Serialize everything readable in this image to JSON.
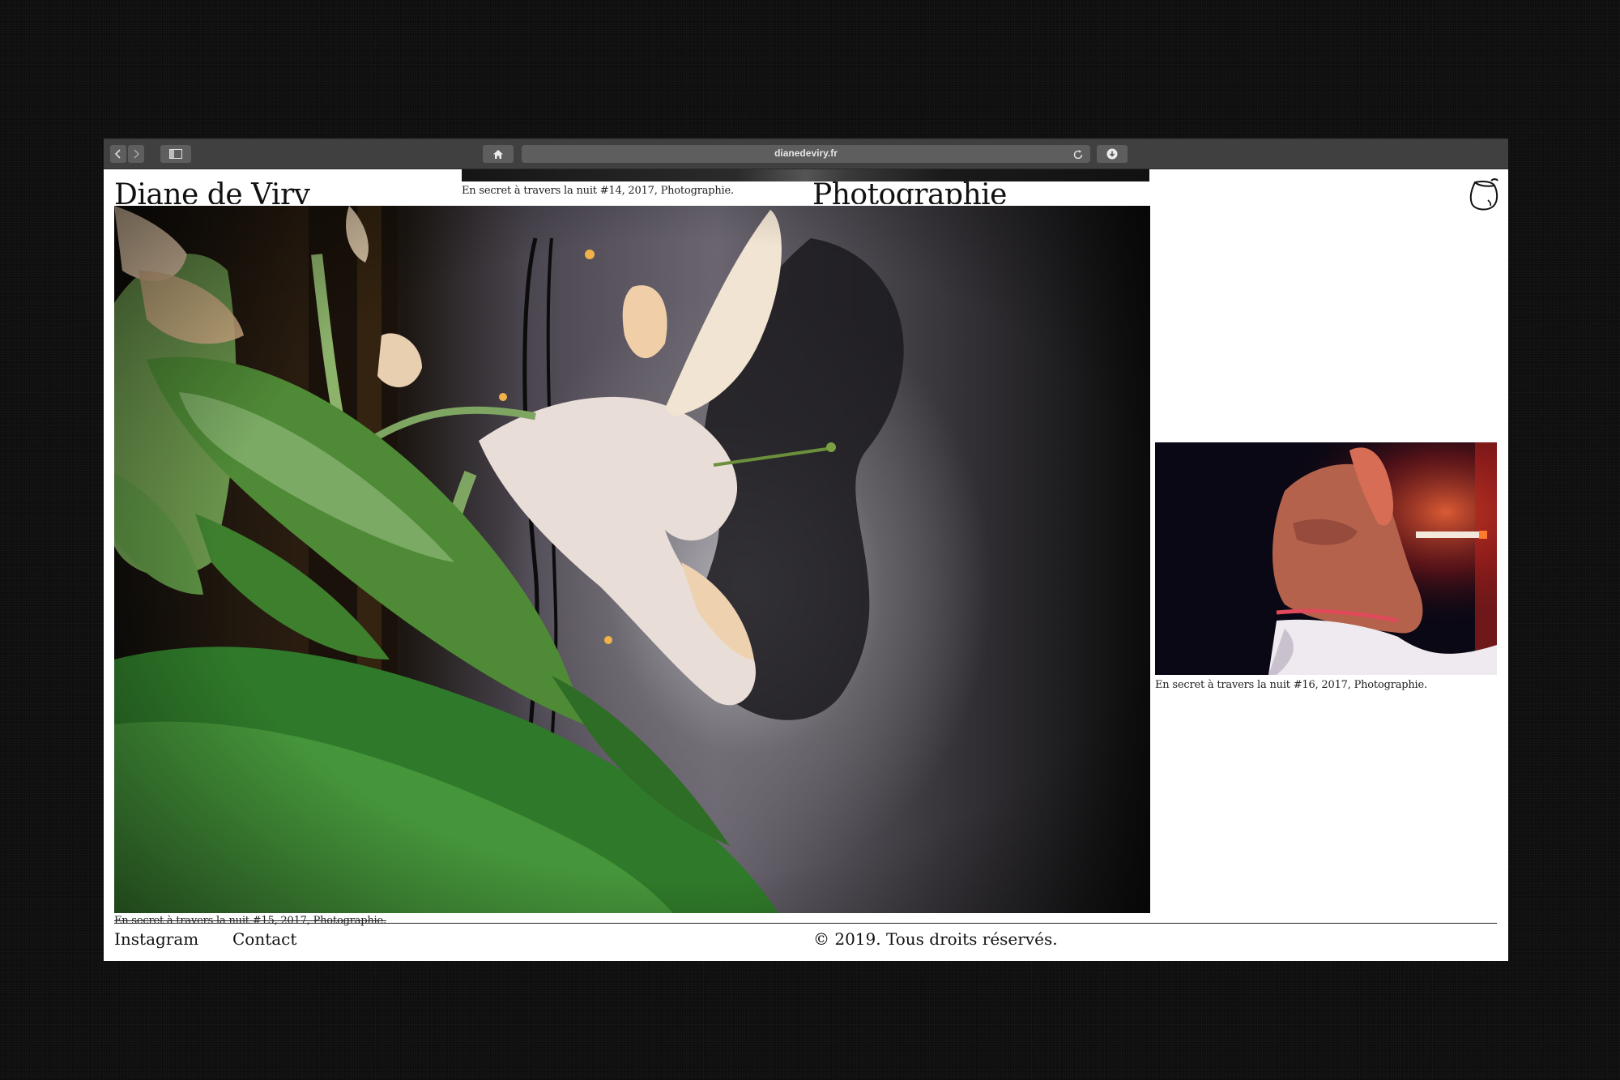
{
  "browser": {
    "url": "dianedeviry.fr",
    "icons": {
      "back": "chevron-left-icon",
      "forward": "chevron-right-icon",
      "sidebar": "sidebar-icon",
      "home": "home-icon",
      "reload": "reload-icon",
      "download": "download-icon"
    }
  },
  "site": {
    "title": "Diane de Viry",
    "section": "Photographie",
    "logo": "lemon-icon"
  },
  "gallery": {
    "top_caption": "En secret à travers la nuit #14, 2017, Photographie.",
    "main_caption": "En secret à travers la nuit #15, 2017, Photographie.",
    "side_caption": "En secret à travers la nuit #16, 2017, Photographie."
  },
  "footer": {
    "instagram": "Instagram",
    "contact": "Contact",
    "copyright": "© 2019. Tous droits réservés."
  },
  "colors": {
    "page_background": "#0d0d0d",
    "toolbar": "#404040",
    "site_background": "#ffffff",
    "text": "#111111"
  }
}
